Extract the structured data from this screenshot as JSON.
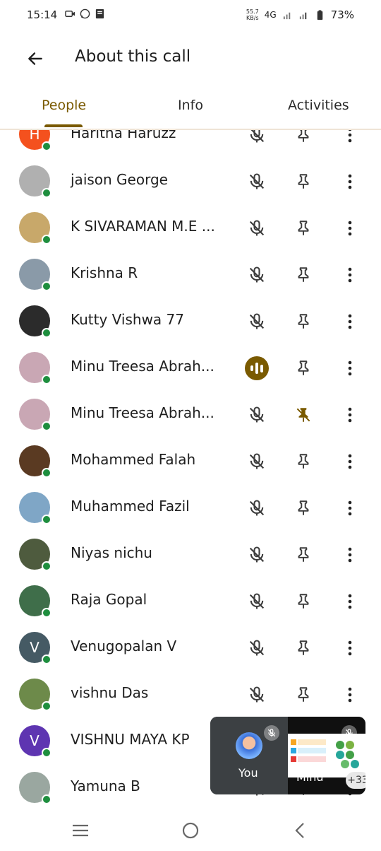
{
  "status_bar": {
    "time": "15:14",
    "net_speed_value": "55.7",
    "net_speed_unit": "KB/s",
    "network": "4G",
    "battery": "73%"
  },
  "header": {
    "title": "About this call",
    "back_icon": "arrow-back-icon"
  },
  "tabs": [
    {
      "label": "People",
      "active": true
    },
    {
      "label": "Info",
      "active": false
    },
    {
      "label": "Activities",
      "active": false
    }
  ],
  "participants": [
    {
      "name": "Haritha Haruzz",
      "avatar_letter": "H",
      "avatar_color": "#f4511e",
      "speaking": false,
      "pinned": false
    },
    {
      "name": "jaison George",
      "avatar_letter": "",
      "avatar_color": "#b0b0b0",
      "speaking": false,
      "pinned": false
    },
    {
      "name": "K SIVARAMAN M.E ...",
      "avatar_letter": "",
      "avatar_color": "#c8a86a",
      "speaking": false,
      "pinned": false
    },
    {
      "name": "Krishna R",
      "avatar_letter": "",
      "avatar_color": "#8a9aa8",
      "speaking": false,
      "pinned": false
    },
    {
      "name": "Kutty Vishwa 77",
      "avatar_letter": "",
      "avatar_color": "#2b2b2b",
      "speaking": false,
      "pinned": false
    },
    {
      "name": "Minu Treesa Abrah...",
      "avatar_letter": "",
      "avatar_color": "#c9a7b4",
      "speaking": true,
      "pinned": false
    },
    {
      "name": "Minu Treesa Abrah...",
      "avatar_letter": "",
      "avatar_color": "#c9a7b4",
      "speaking": false,
      "pinned": true
    },
    {
      "name": "Mohammed Falah",
      "avatar_letter": "",
      "avatar_color": "#5a3a22",
      "speaking": false,
      "pinned": false
    },
    {
      "name": "Muhammed Fazil",
      "avatar_letter": "",
      "avatar_color": "#7fa6c6",
      "speaking": false,
      "pinned": false
    },
    {
      "name": "Niyas nichu",
      "avatar_letter": "",
      "avatar_color": "#4e5b3e",
      "speaking": false,
      "pinned": false
    },
    {
      "name": "Raja Gopal",
      "avatar_letter": "",
      "avatar_color": "#3f6e4a",
      "speaking": false,
      "pinned": false
    },
    {
      "name": "Venugopalan V",
      "avatar_letter": "V",
      "avatar_color": "#455a64",
      "speaking": false,
      "pinned": false
    },
    {
      "name": "vishnu Das",
      "avatar_letter": "",
      "avatar_color": "#6d8a4a",
      "speaking": false,
      "pinned": false
    },
    {
      "name": "VISHNU MAYA KP",
      "avatar_letter": "V",
      "avatar_color": "#5e35b1",
      "speaking": false,
      "pinned": false
    },
    {
      "name": "Yamuna B",
      "avatar_letter": "",
      "avatar_color": "#9aa7a0",
      "speaking": false,
      "pinned": false
    }
  ],
  "pip": {
    "self_label": "You",
    "presenter_label": "Minu",
    "more_count": "+33"
  },
  "colors": {
    "accent": "#7a5a00",
    "online": "#1e8e3e"
  }
}
